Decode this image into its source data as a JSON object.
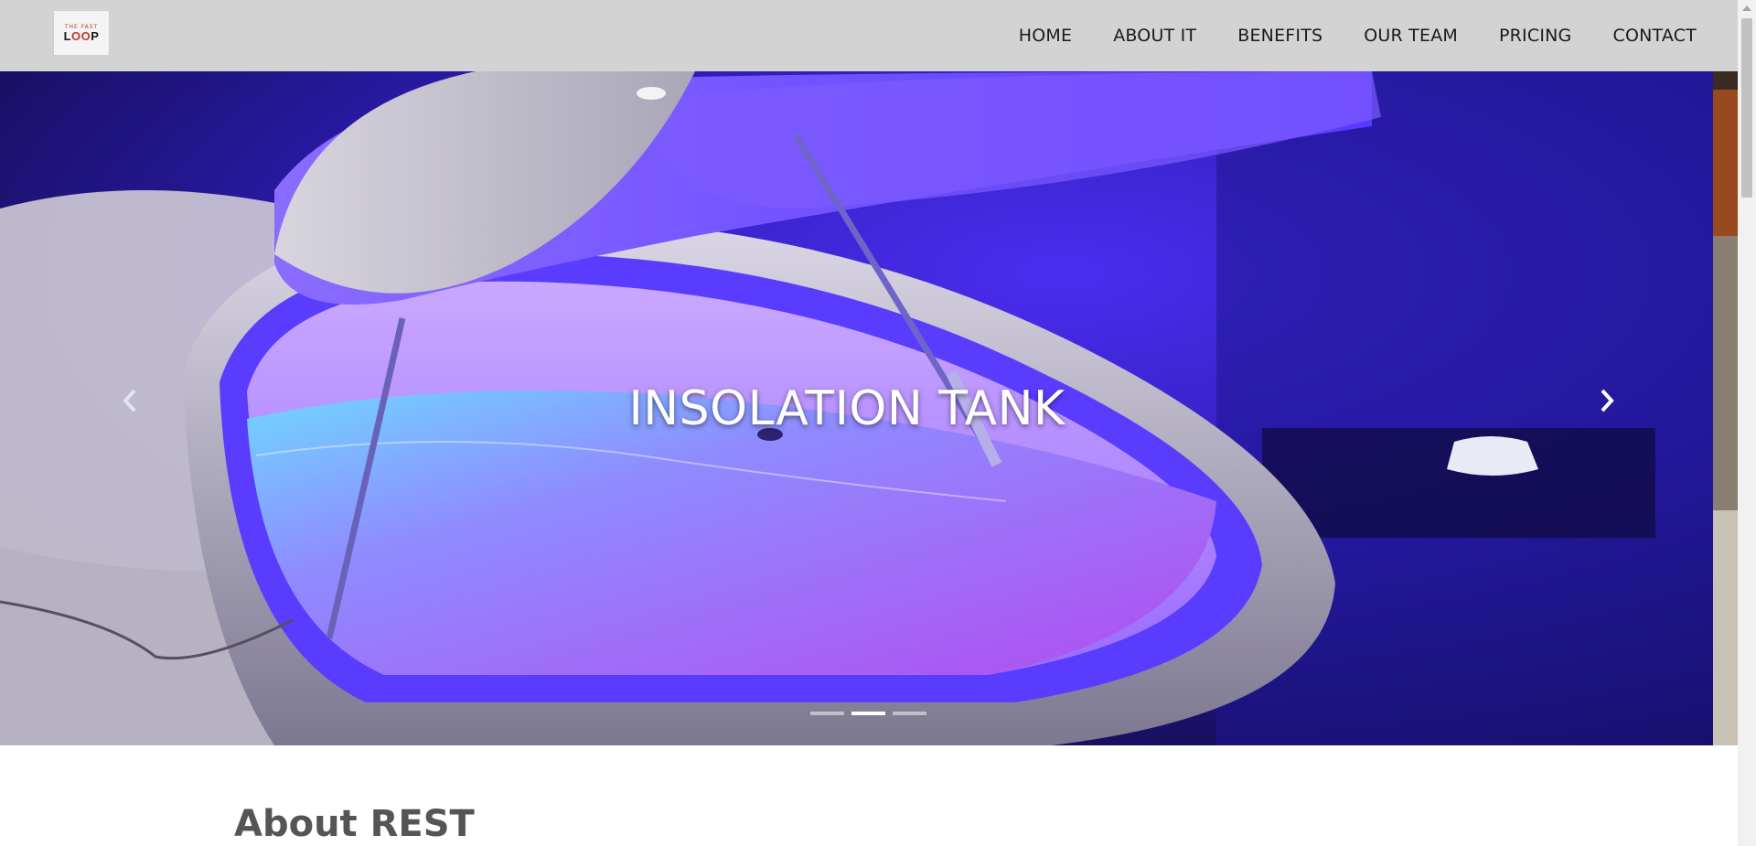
{
  "brand": {
    "logo_small": "THE FAST",
    "logo_main": "LOOP"
  },
  "nav": {
    "items": [
      {
        "label": "HOME"
      },
      {
        "label": "ABOUT IT"
      },
      {
        "label": "BENEFITS"
      },
      {
        "label": "OUR TEAM"
      },
      {
        "label": "PRICING"
      },
      {
        "label": "CONTACT"
      }
    ]
  },
  "carousel": {
    "caption": "INSOLATION TANK",
    "prev_icon": "chevron-left-icon",
    "next_icon": "chevron-right-icon",
    "slide_count": 3,
    "active_index": 1
  },
  "about": {
    "heading": "About REST"
  },
  "colors": {
    "navbar_bg": "#d3d3d3",
    "hero_glow": "#6a3cff",
    "pod_shell": "#e8e6ef",
    "heading_text": "#555555"
  }
}
